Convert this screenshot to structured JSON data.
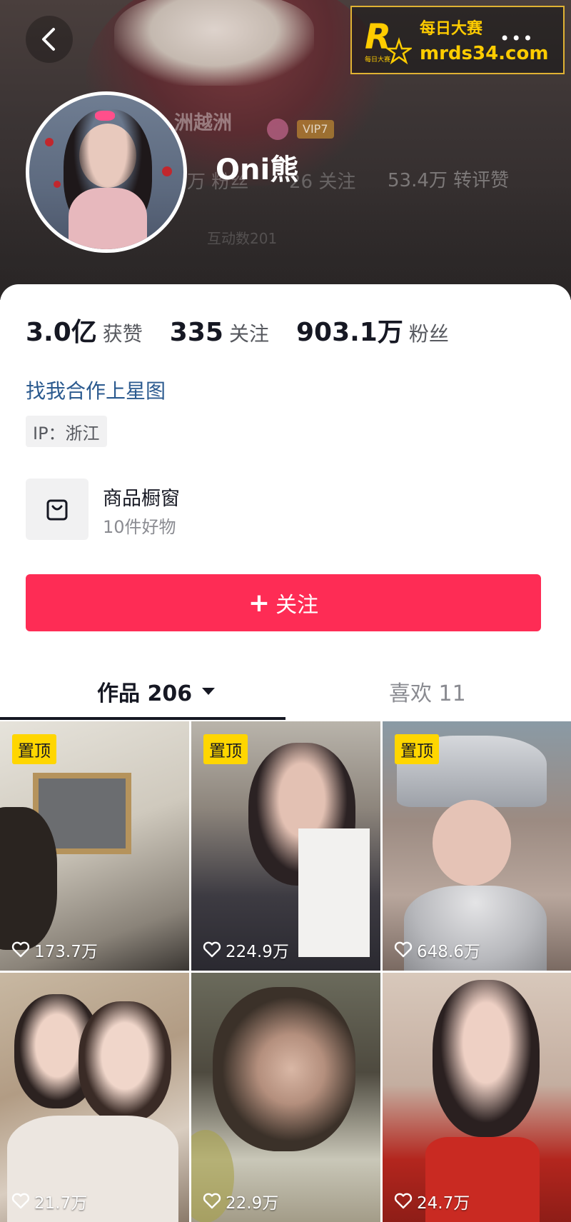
{
  "header": {
    "back_icon": "chevron-left-icon",
    "more_icon": "more-dots-icon",
    "more_label": "•••",
    "username": "Oni熊",
    "cover_ghost": {
      "name_text": "洲越洲",
      "vip_text": "VIP7",
      "stat_a": "万 粉丝",
      "stat_b": "26 关注",
      "stat_c": "53.4万 转评赞",
      "interact": "互动数201"
    }
  },
  "watermark": {
    "logo_letter": "R",
    "logo_caption": "每日大赛",
    "line1": "每日大赛",
    "line2": "mrds34.com"
  },
  "profile": {
    "stats": [
      {
        "value": "3.0亿",
        "label": "获赞"
      },
      {
        "value": "335",
        "label": "关注"
      },
      {
        "value": "903.1万",
        "label": "粉丝"
      }
    ],
    "coop_link": "找我合作上星图",
    "ip_tag": "IP：浙江",
    "shop": {
      "icon": "shopping-bag-icon",
      "title": "商品橱窗",
      "subtitle": "10件好物"
    },
    "follow_button": {
      "plus": "+",
      "label": "关注"
    },
    "tabs": [
      {
        "label": "作品 206",
        "active": true,
        "icon": "caret-down-icon"
      },
      {
        "label": "喜欢 11",
        "active": false
      }
    ]
  },
  "videos": [
    {
      "pinned": true,
      "pin_label": "置顶",
      "likes": "173.7万"
    },
    {
      "pinned": true,
      "pin_label": "置顶",
      "likes": "224.9万"
    },
    {
      "pinned": true,
      "pin_label": "置顶",
      "likes": "648.6万"
    },
    {
      "pinned": false,
      "likes": "21.7万"
    },
    {
      "pinned": false,
      "likes": "22.9万"
    },
    {
      "pinned": false,
      "likes": "24.7万"
    }
  ],
  "colors": {
    "accent": "#fe2c55",
    "pin_badge": "#ffd600",
    "link": "#2b5a8f",
    "vip_badge": "#e2a431"
  }
}
